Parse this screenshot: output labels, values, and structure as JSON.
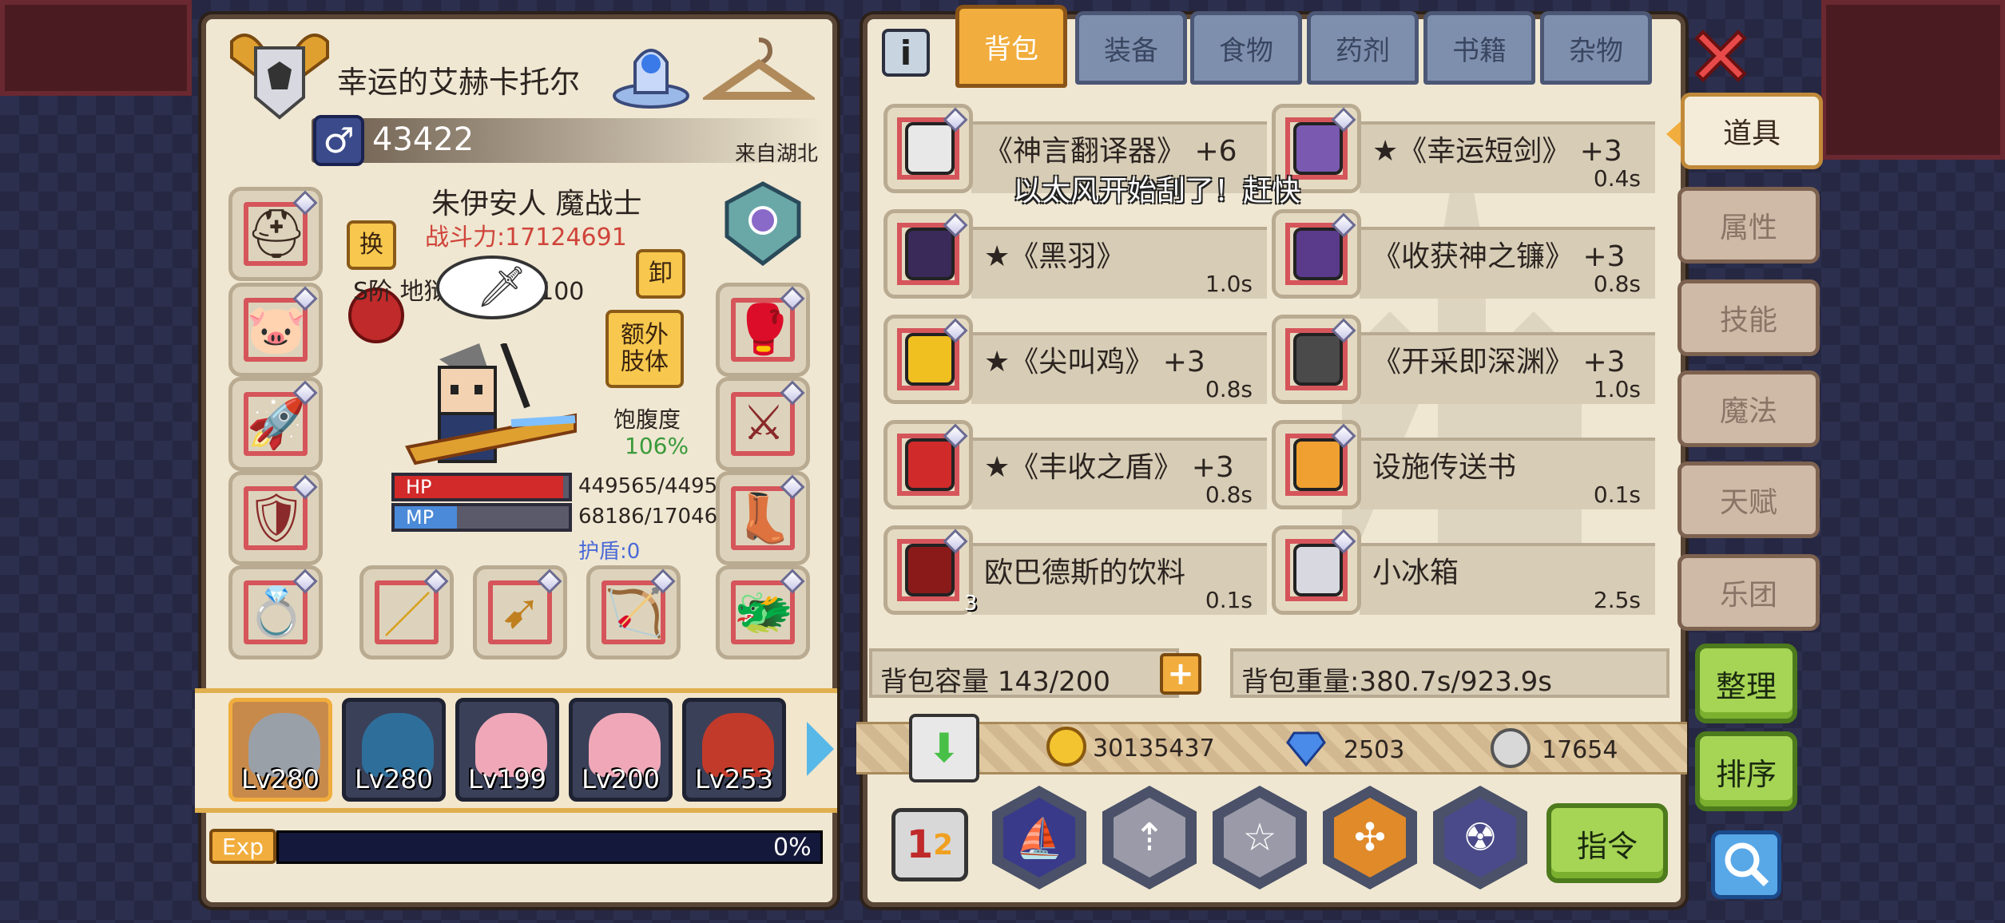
{
  "character": {
    "title": "幸运的艾赫卡托尔",
    "id": "43422",
    "origin": "来自湖北",
    "name_class": "朱伊安人 魔战士",
    "power": "战斗力:17124691",
    "rank_title": "S阶 地狱使徒 Lv 100",
    "bubble": "以太风开始刮了！赶快",
    "satiety_label": "饱腹度",
    "satiety_value": "106%",
    "hp_label": "HP",
    "hp_value": "449565/4495",
    "hp_fraction": 0.97,
    "mp_label": "MP",
    "mp_value": "68186/17046",
    "mp_fraction": 0.36,
    "shield": "护盾:0",
    "btn_swap": "换",
    "btn_unequip": "卸",
    "btn_extra_limb": "额外肢体"
  },
  "exp": {
    "label": "Exp",
    "value": "0%",
    "fraction": 0
  },
  "party": [
    {
      "level": "Lv280",
      "color": "#9aa0a8"
    },
    {
      "level": "Lv280",
      "color": "#2e6e9a"
    },
    {
      "level": "Lv199",
      "color": "#f0a8b8"
    },
    {
      "level": "Lv200",
      "color": "#f0a8b8"
    },
    {
      "level": "Lv253",
      "color": "#c23a2a"
    }
  ],
  "tabs": {
    "info_icon": "info-icon",
    "items": [
      "背包",
      "装备",
      "食物",
      "药剂",
      "书籍",
      "杂物"
    ]
  },
  "inventory": [
    {
      "name": "《神言翻译器》 +6",
      "time": "",
      "icon": "headphones-icon",
      "color": "#e8e8e8"
    },
    {
      "name": "★《幸运短剑》 +3",
      "time": "0.4s",
      "icon": "dagger-icon",
      "color": "#7a5ab0"
    },
    {
      "name": "★《黑羽》",
      "time": "1.0s",
      "icon": "black-feather-icon",
      "color": "#3a2a5a"
    },
    {
      "name": "《收获神之镰》 +3",
      "time": "0.8s",
      "icon": "scythe-icon",
      "color": "#5a3a8a"
    },
    {
      "name": "★《尖叫鸡》 +3",
      "time": "0.8s",
      "icon": "rubber-chicken-icon",
      "color": "#f0c020"
    },
    {
      "name": "《开采即深渊》 +3",
      "time": "1.0s",
      "icon": "pickaxe-icon",
      "color": "#4a4a4a"
    },
    {
      "name": "★《丰收之盾》 +3",
      "time": "0.8s",
      "icon": "shield-icon",
      "color": "#d02a2a"
    },
    {
      "name": "设施传送书",
      "time": "0.1s",
      "icon": "book-icon",
      "color": "#f0a030"
    },
    {
      "name": "欧巴德斯的饮料",
      "time": "0.1s",
      "icon": "bottle-icon",
      "color": "#8a1a1a",
      "count": "3"
    },
    {
      "name": "小冰箱",
      "time": "2.5s",
      "icon": "fridge-icon",
      "color": "#d8d8e0"
    }
  ],
  "capacity": "背包容量 143/200",
  "weight": "背包重量:380.7s/923.9s",
  "currency": {
    "gold": "30135437",
    "diamond": "2503",
    "silver": "17654"
  },
  "side_tabs": [
    "道具",
    "属性",
    "技能",
    "魔法",
    "天赋",
    "乐团"
  ],
  "buttons": {
    "sort": "整理",
    "order": "排序",
    "command": "指令"
  },
  "colors": {
    "accent": "#f1ad3d",
    "hp": "#d22a2a",
    "mp": "#4a8ad8",
    "power": "#d0443a",
    "satiety": "#3a9a3a"
  }
}
